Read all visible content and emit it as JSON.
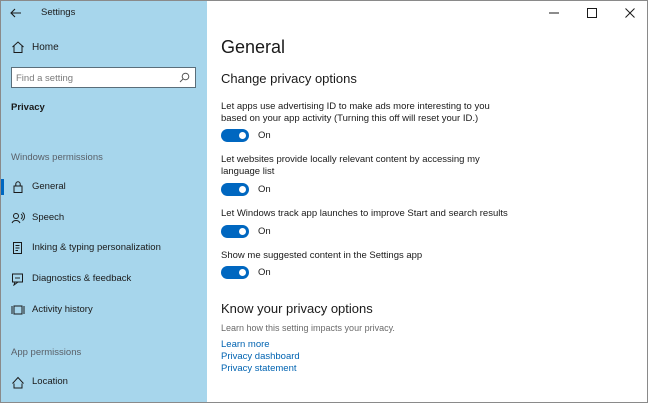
{
  "window": {
    "title": "Settings"
  },
  "sidebar": {
    "home_label": "Home",
    "search_placeholder": "Find a setting",
    "category": "Privacy",
    "section_windows": "Windows permissions",
    "items": [
      {
        "label": "General",
        "icon": "lock-icon",
        "selected": true
      },
      {
        "label": "Speech",
        "icon": "speech-icon"
      },
      {
        "label": "Inking & typing personalization",
        "icon": "inking-icon"
      },
      {
        "label": "Diagnostics & feedback",
        "icon": "diagnostics-icon"
      },
      {
        "label": "Activity history",
        "icon": "activity-icon"
      }
    ],
    "section_app": "App permissions",
    "app_items": [
      {
        "label": "Location",
        "icon": "location-icon"
      }
    ]
  },
  "main": {
    "title": "General",
    "heading": "Change privacy options",
    "options": [
      {
        "text": "Let apps use advertising ID to make ads more interesting to you based on your app activity (Turning this off will reset your ID.)",
        "state": "On"
      },
      {
        "text": "Let websites provide locally relevant content by accessing my language list",
        "state": "On"
      },
      {
        "text": "Let Windows track app launches to improve Start and search results",
        "state": "On"
      },
      {
        "text": "Show me suggested content in the Settings app",
        "state": "On"
      }
    ],
    "know_heading": "Know your privacy options",
    "know_sub": "Learn how this setting impacts your privacy.",
    "links": [
      "Learn more",
      "Privacy dashboard",
      "Privacy statement"
    ]
  },
  "colors": {
    "accent": "#0067c0",
    "sidebar_bg": "#a7d6ec",
    "link": "#0063b1"
  }
}
